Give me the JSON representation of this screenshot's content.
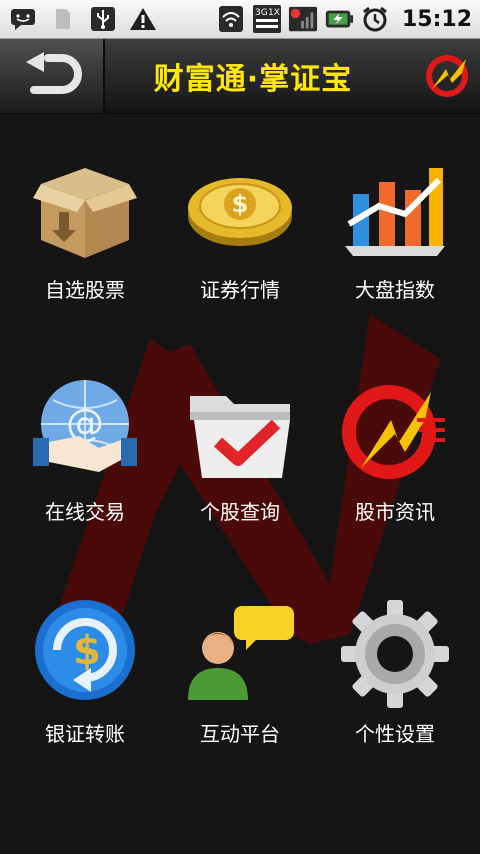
{
  "status_bar": {
    "time": "15:12"
  },
  "header": {
    "title": "财富通·掌证宝"
  },
  "menu": {
    "items": [
      {
        "label": "自选股票"
      },
      {
        "label": "证券行情"
      },
      {
        "label": "大盘指数"
      },
      {
        "label": "在线交易"
      },
      {
        "label": "个股查询"
      },
      {
        "label": "股市资讯"
      },
      {
        "label": "银证转账"
      },
      {
        "label": "互动平台"
      },
      {
        "label": "个性设置"
      }
    ]
  }
}
